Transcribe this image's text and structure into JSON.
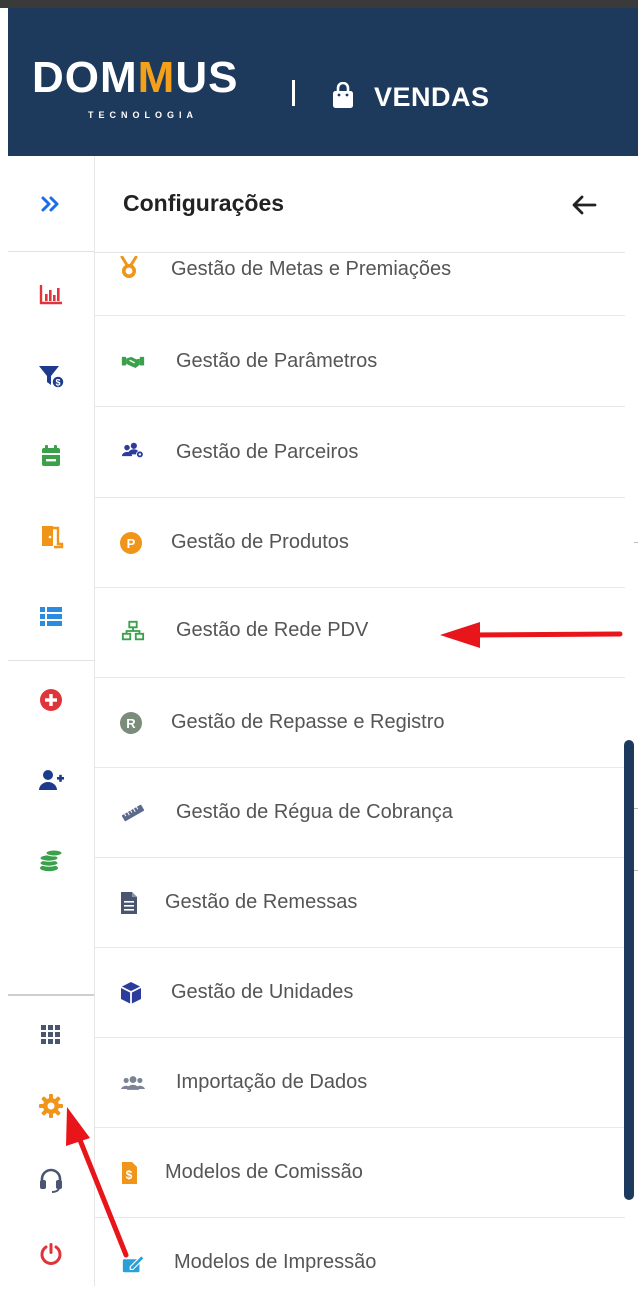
{
  "header": {
    "logo_text": "DOMMUS",
    "logo_subtext": "TECNOLOGIA",
    "module_title": "VENDAS"
  },
  "panel": {
    "title": "Configurações",
    "items": [
      {
        "label": "Gestão de Metas e Premiações",
        "icon": "medal-icon"
      },
      {
        "label": "Gestão de Parâmetros",
        "icon": "handshake-icon"
      },
      {
        "label": "Gestão de Parceiros",
        "icon": "partners-icon"
      },
      {
        "label": "Gestão de Produtos",
        "icon": "product-p-icon"
      },
      {
        "label": "Gestão de Rede PDV",
        "icon": "network-icon"
      },
      {
        "label": "Gestão de Repasse e Registro",
        "icon": "registro-r-icon"
      },
      {
        "label": "Gestão de Régua de Cobrança",
        "icon": "ruler-icon"
      },
      {
        "label": "Gestão de Remessas",
        "icon": "document-icon"
      },
      {
        "label": "Gestão de Unidades",
        "icon": "cube-icon"
      },
      {
        "label": "Importação de Dados",
        "icon": "users-icon"
      },
      {
        "label": "Modelos de Comissão",
        "icon": "money-file-icon"
      },
      {
        "label": "Modelos de Impressão",
        "icon": "print-edit-icon"
      }
    ]
  },
  "sidebar": {
    "items": [
      {
        "name": "expand-icon"
      },
      {
        "name": "chart-icon"
      },
      {
        "name": "funnel-money-icon"
      },
      {
        "name": "calendar-icon"
      },
      {
        "name": "door-icon"
      },
      {
        "name": "list-icon"
      },
      {
        "name": "plus-circle-icon"
      },
      {
        "name": "add-user-icon"
      },
      {
        "name": "coins-icon"
      },
      {
        "name": "grid-icon"
      },
      {
        "name": "gear-icon"
      },
      {
        "name": "headset-icon"
      },
      {
        "name": "power-icon"
      }
    ]
  },
  "colors": {
    "header_bg": "#1d3a5c",
    "accent_orange": "#f5a01a",
    "annotation_red": "#e8151b"
  }
}
